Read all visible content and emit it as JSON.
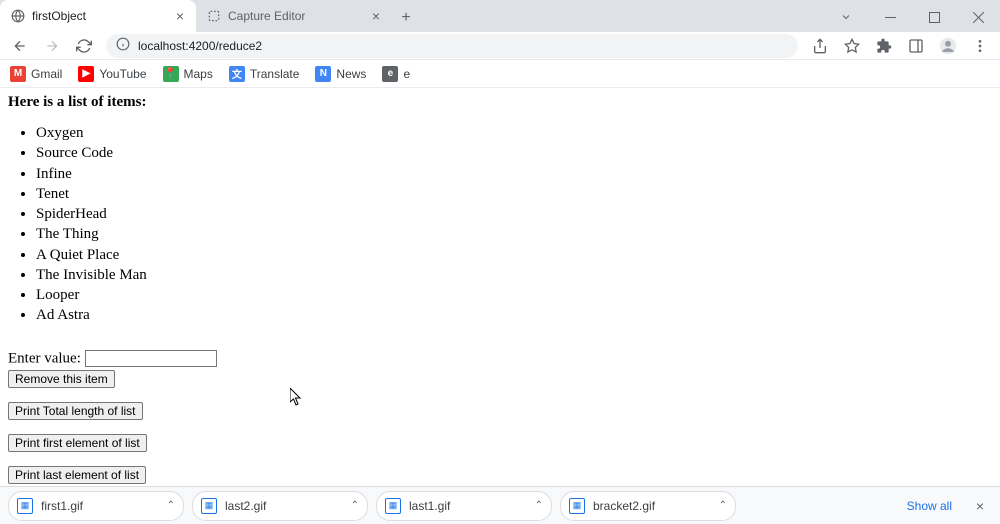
{
  "tabs": [
    {
      "title": "firstObject",
      "active": true
    },
    {
      "title": "Capture Editor",
      "active": false
    }
  ],
  "url": "localhost:4200/reduce2",
  "bookmarks": [
    {
      "name": "Gmail",
      "icon_bg": "#ea4335",
      "icon_text": "M"
    },
    {
      "name": "YouTube",
      "icon_bg": "#ff0000",
      "icon_text": "▶"
    },
    {
      "name": "Maps",
      "icon_bg": "#34a853",
      "icon_text": "📍"
    },
    {
      "name": "Translate",
      "icon_bg": "#4285f4",
      "icon_text": "文"
    },
    {
      "name": "News",
      "icon_bg": "#4285f4",
      "icon_text": "N"
    },
    {
      "name": "e",
      "icon_bg": "#5f6368",
      "icon_text": "e"
    }
  ],
  "page": {
    "heading": "Here is a list of items:",
    "items": [
      "Oxygen",
      "Source Code",
      "Infine",
      "Tenet",
      "SpiderHead",
      "The Thing",
      "A Quiet Place",
      "The Invisible Man",
      "Looper",
      "Ad Astra"
    ],
    "input_label": "Enter value: ",
    "buttons": {
      "remove": "Remove this item",
      "total": "Print Total length of list",
      "first": "Print first element of list",
      "last": "Print last element of list"
    }
  },
  "downloads": {
    "items": [
      "first1.gif",
      "last2.gif",
      "last1.gif",
      "bracket2.gif"
    ],
    "show_all": "Show all"
  }
}
